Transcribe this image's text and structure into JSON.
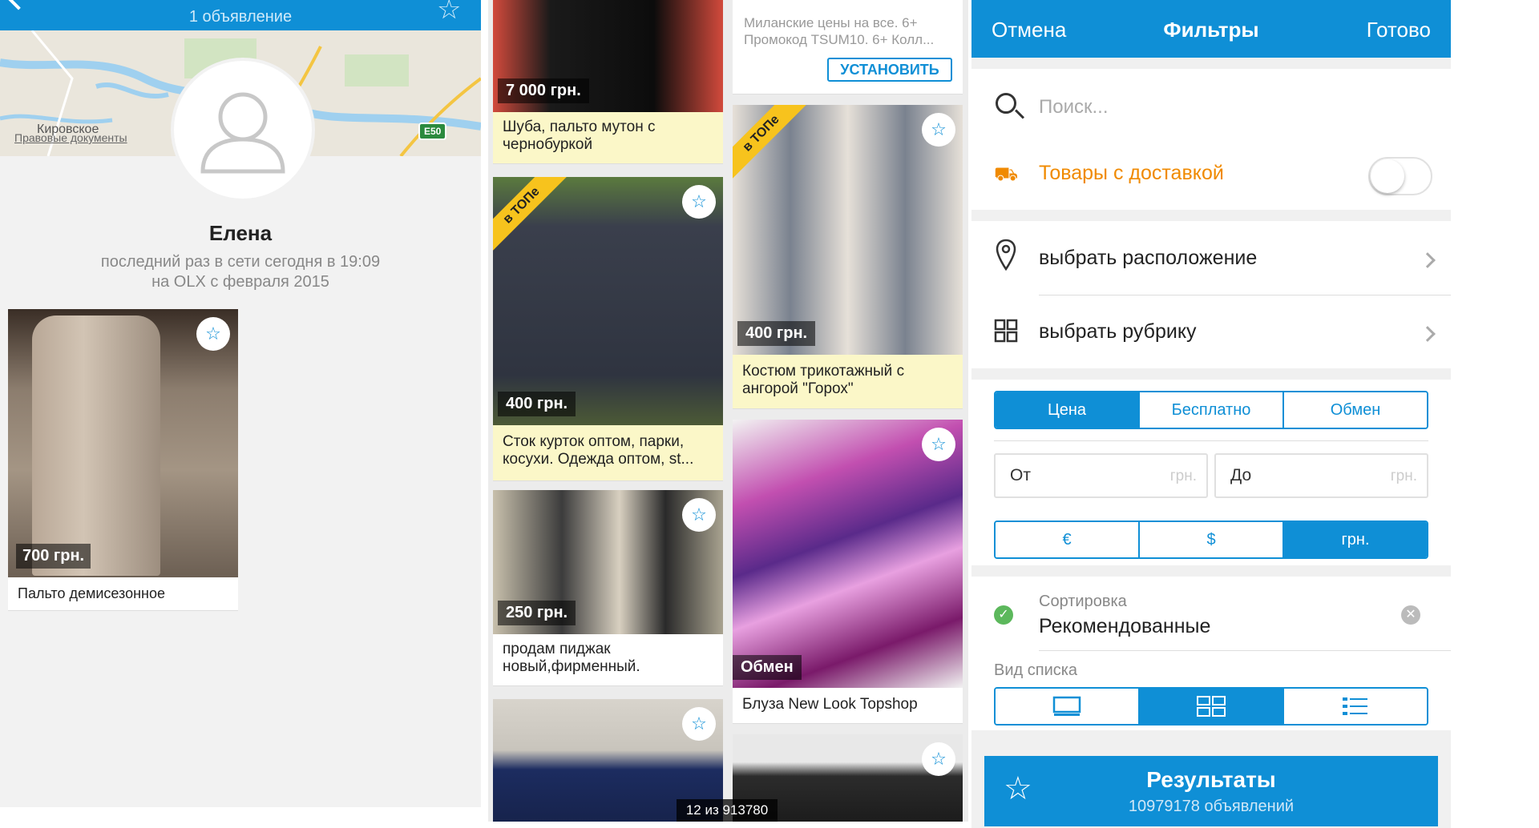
{
  "profile": {
    "header_count": "1 объявление",
    "map_city": "Кировское",
    "map_legal": "Правовые документы",
    "map_road": "E50",
    "seller_name": "Елена",
    "last_seen": "последний раз в сети сегодня в 19:09",
    "since": "на OLX с февраля 2015",
    "listing": {
      "price": "700 грн.",
      "title": "Пальто демисезонное"
    }
  },
  "grid": {
    "ad": {
      "text1": "Миланские цены на все. 6+",
      "text2": "Промокод TSUM10. 6+ Колл...",
      "button": "УСТАНОВИТЬ"
    },
    "top_badge": "в ТОПе",
    "items": [
      {
        "price": "7 000 грн.",
        "title": "Шуба, пальто мутон с чернобуркой"
      },
      {
        "price": "400 грн.",
        "title": "Сток курток оптом, парки, косухи. Одежда оптом, st..."
      },
      {
        "price": "250 грн.",
        "title": "продам пиджак новый,фирменный."
      },
      {
        "price": "400 грн.",
        "title": "Костюм трикотажный с ангорой \"Горох\""
      },
      {
        "price": "Обмен",
        "title": "Блуза New Look Topshop"
      }
    ],
    "pager": "12 из 913780"
  },
  "filters": {
    "cancel": "Отмена",
    "title": "Фильтры",
    "done": "Готово",
    "search_placeholder": "Поиск...",
    "delivery": "Товары с доставкой",
    "location": "выбрать расположение",
    "category": "выбрать рубрику",
    "price_tabs": [
      "Цена",
      "Бесплатно",
      "Обмен"
    ],
    "from": "От",
    "to": "До",
    "unit": "грн.",
    "currencies": [
      "€",
      "$",
      "грн."
    ],
    "sort_label": "Сортировка",
    "sort_value": "Рекомендованные",
    "view_label": "Вид списка",
    "results_title": "Результаты",
    "results_count": "10979178 объявлений"
  },
  "colors": {
    "accent": "#0f8fd6",
    "orange": "#f08a00",
    "top_badge": "#f7c31d"
  }
}
